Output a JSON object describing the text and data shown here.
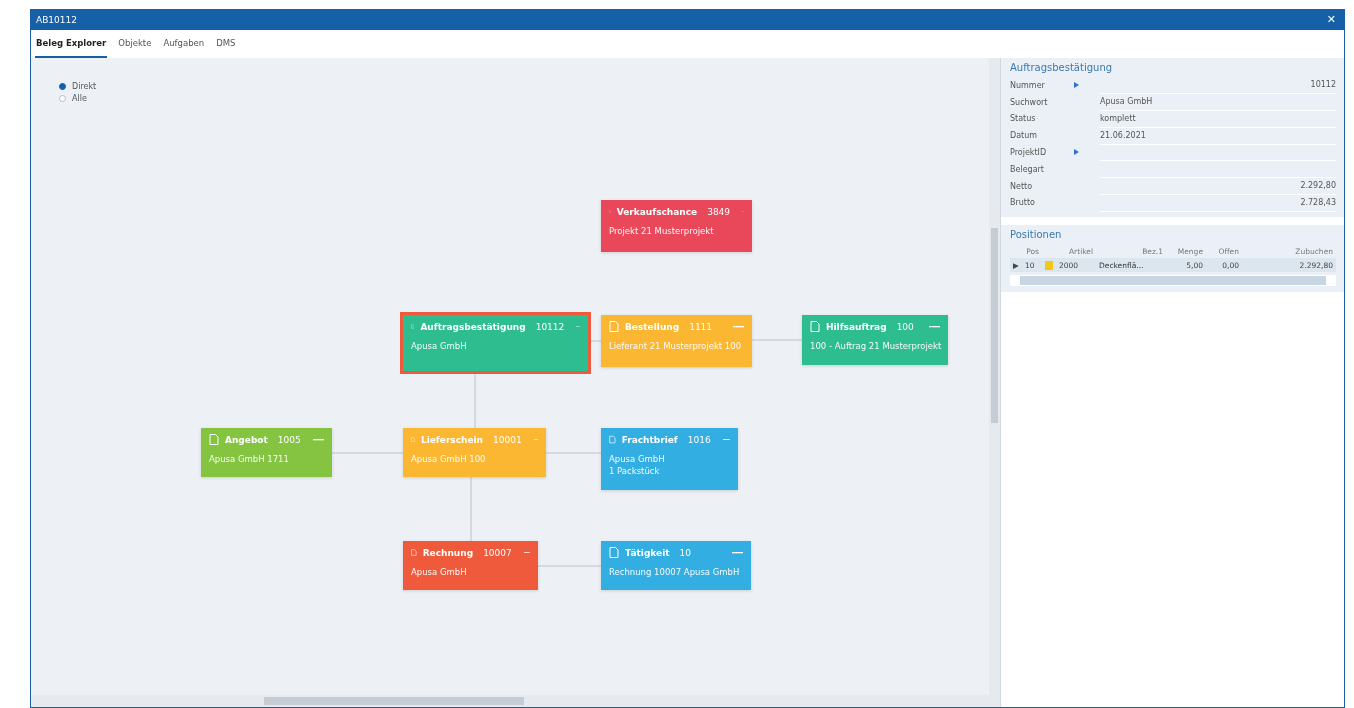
{
  "window": {
    "title": "AB10112",
    "close": "✕"
  },
  "tabs": [
    {
      "label": "Beleg Explorer",
      "selected": true
    },
    {
      "label": "Objekte",
      "selected": false
    },
    {
      "label": "Aufgaben",
      "selected": false
    },
    {
      "label": "DMS",
      "selected": false
    }
  ],
  "filter": [
    {
      "label": "Direkt",
      "selected": true
    },
    {
      "label": "Alle",
      "selected": false
    }
  ],
  "cards": [
    {
      "title": "Verkaufschance",
      "number": "3849",
      "lines": [
        "Projekt 21 Musterprojekt"
      ],
      "color": "#e8485a",
      "selected": false
    },
    {
      "title": "Auftragsbestätigung",
      "number": "10112",
      "lines": [
        "Apusa GmbH"
      ],
      "color": "#2ebd8f",
      "selected": true
    },
    {
      "title": "Bestellung",
      "number": "1111",
      "lines": [
        "Lieferant 21 Musterprojekt 100"
      ],
      "color": "#fbb731",
      "selected": false
    },
    {
      "title": "Hilfsauftrag",
      "number": "100",
      "lines": [
        "100 - Auftrag 21 Musterprojekt"
      ],
      "color": "#2ebd8f",
      "selected": false
    },
    {
      "title": "Angebot",
      "number": "1005",
      "lines": [
        "Apusa GmbH 1711"
      ],
      "color": "#84c441",
      "selected": false
    },
    {
      "title": "Lieferschein",
      "number": "10001",
      "lines": [
        "Apusa GmbH 100"
      ],
      "color": "#fbb731",
      "selected": false
    },
    {
      "title": "Frachtbrief",
      "number": "1016",
      "lines": [
        "Apusa GmbH",
        "1 Packstück"
      ],
      "color": "#33aee3",
      "selected": false
    },
    {
      "title": "Rechnung",
      "number": "10007",
      "lines": [
        "Apusa GmbH"
      ],
      "color": "#f05a3c",
      "selected": false
    },
    {
      "title": "Tätigkeit",
      "number": "10",
      "lines": [
        "Rechnung 10007 Apusa GmbH"
      ],
      "color": "#33aee3",
      "selected": false
    }
  ],
  "details": {
    "title": "Auftragsbestätigung",
    "fields": [
      {
        "label": "Nummer",
        "value": "10112",
        "link": true
      },
      {
        "label": "Suchwort",
        "value": "Apusa GmbH",
        "link": false
      },
      {
        "label": "Status",
        "value": "komplett",
        "link": false
      },
      {
        "label": "Datum",
        "value": "21.06.2021",
        "link": false
      },
      {
        "label": "ProjektID",
        "link": true
      },
      {
        "label": "Belegart",
        "link": false
      },
      {
        "label": "Netto",
        "value": "2.292,80",
        "link": false
      },
      {
        "label": "Brutto",
        "value": "2.728,43",
        "link": false
      }
    ]
  },
  "positions": {
    "title": "Positionen",
    "columns": [
      "Pos",
      "Artikel",
      "Bez.1",
      "Menge",
      "Offen",
      "Zubuchen"
    ],
    "rows": [
      {
        "cells": [
          "10",
          "2000",
          "Deckenflä...",
          "5,00",
          "0,00",
          "2.292,80"
        ],
        "marker": "▶",
        "color": "#f5c518"
      }
    ]
  }
}
